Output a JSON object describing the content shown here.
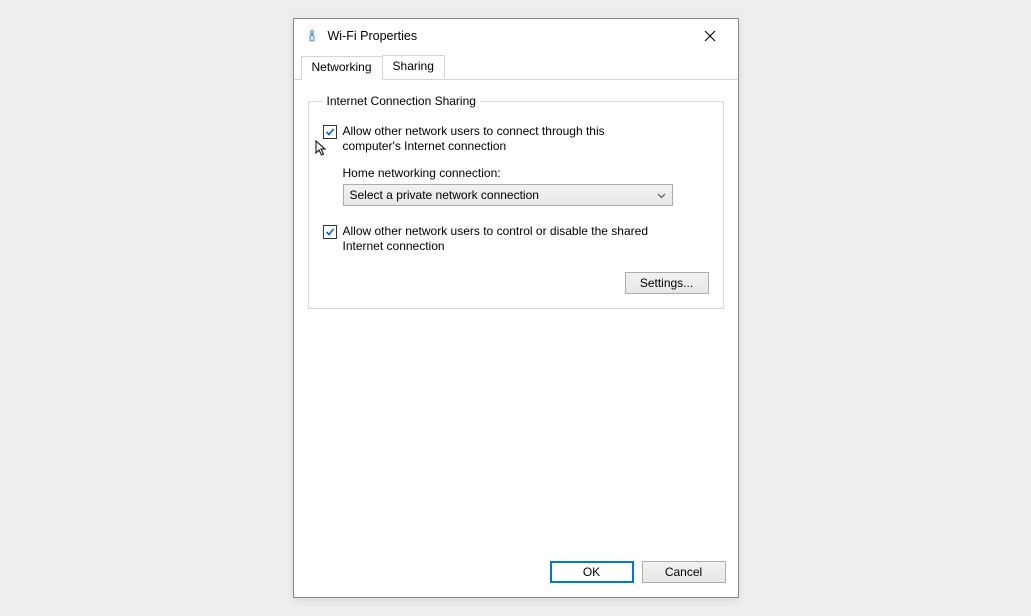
{
  "window": {
    "title": "Wi-Fi Properties",
    "icon": "wifi-adapter-icon"
  },
  "tabs": {
    "networking": "Networking",
    "sharing": "Sharing",
    "active": "sharing"
  },
  "group": {
    "legend": "Internet Connection Sharing",
    "allow_connect": {
      "checked": true,
      "label": "Allow other network users to connect through this computer's Internet connection"
    },
    "home_conn": {
      "label": "Home networking connection:",
      "selected": "Select a private network connection"
    },
    "allow_control": {
      "checked": true,
      "label": "Allow other network users to control or disable the shared Internet connection"
    },
    "settings_btn": "Settings..."
  },
  "footer": {
    "ok": "OK",
    "cancel": "Cancel"
  }
}
